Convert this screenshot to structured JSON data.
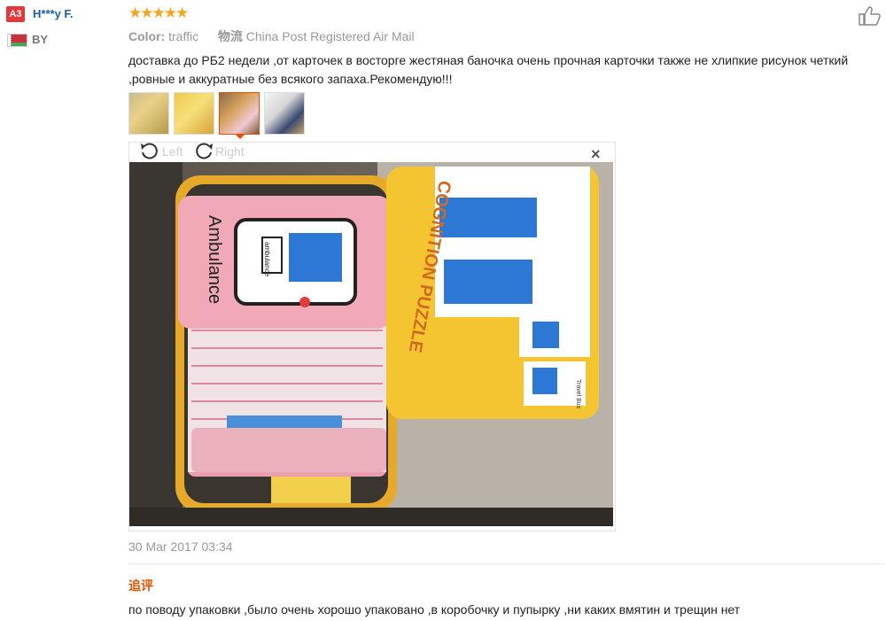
{
  "user": {
    "level": "A3",
    "name": "H***y F.",
    "country": "BY"
  },
  "rating": {
    "stars": 5,
    "star_glyph": "★",
    "color": "#f5a623"
  },
  "sku": {
    "color_key": "Color:",
    "color_value": "traffic",
    "shipping_key": "物流",
    "shipping_value": "China Post Registered Air Mail"
  },
  "review_text": "доставка до РБ2 недели ,от карточек в восторге жестяная баночка очень прочная карточки также не хлипкие рисунок четкий ,ровные и аккуратные без всякого запаха.Рекомендую!!!",
  "viewer": {
    "rotate_left": "Left",
    "rotate_right": "Right",
    "close": "×",
    "photo_texts": {
      "card_title": "Ambulance",
      "card_sign": "ambulance",
      "box_title": "COGNITION PUZZLE",
      "box_card_label": "Travel Bus"
    }
  },
  "timestamp": "30 Mar 2017 03:34",
  "followup": {
    "label": "追评",
    "text": "по поводу упаковки ,было очень хорошо упаковано ,в коробочку и пупырку ,ни каких вмятин и трещин нет"
  },
  "colors": {
    "accent": "#e65100",
    "username": "#1a5fa8",
    "badge": "#e4393c"
  }
}
